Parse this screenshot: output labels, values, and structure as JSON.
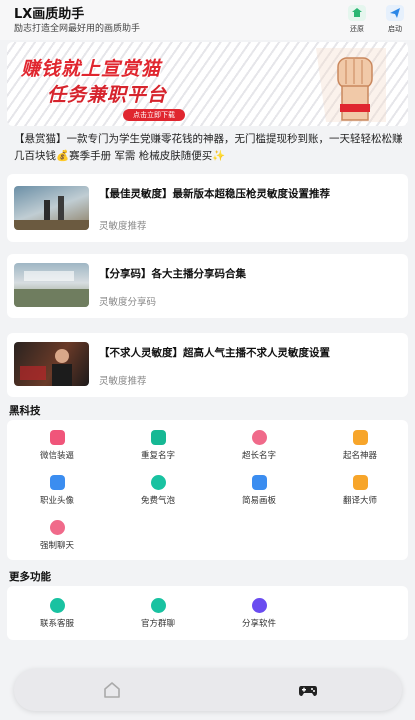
{
  "header": {
    "title": "LX画质助手",
    "subtitle": "励志打造全网最好用的画质助手",
    "buttons": [
      {
        "label": "还原",
        "icon": "restore-icon",
        "color": "#2bb673"
      },
      {
        "label": "启动",
        "icon": "launch-icon",
        "color": "#2b86e6"
      }
    ]
  },
  "banner": {
    "line1": "赚钱就上宣赏猫",
    "line2": "任务兼职平台",
    "cta": "点击立即下载",
    "accent": "#e0262f"
  },
  "description": "【悬赏猫】一款专门为学生党赚零花钱的神器，无门槛提现秒到账，一天轻轻松松赚几百块钱💰赛季手册 军需 枪械皮肤随便买✨",
  "articles": [
    {
      "title": "【最佳灵敏度】最新版本超稳压枪灵敏度设置推荐",
      "tag": "灵敏度推荐"
    },
    {
      "title": "【分享码】各大主播分享码合集",
      "tag": "灵敏度分享码"
    },
    {
      "title": "【不求人灵敏度】超高人气主播不求人灵敏度设置",
      "tag": "灵敏度推荐"
    }
  ],
  "black_tech": {
    "label": "黑科技",
    "items": [
      {
        "label": "微信装逼",
        "icon": "wechat-flex-icon",
        "color": "#f0557a"
      },
      {
        "label": "重复名字",
        "icon": "duplicate-name-icon",
        "color": "#16b894"
      },
      {
        "label": "超长名字",
        "icon": "long-name-icon",
        "color": "#f06a8a"
      },
      {
        "label": "起名神器",
        "icon": "naming-tool-icon",
        "color": "#f7a52a"
      },
      {
        "label": "职业头像",
        "icon": "pro-avatar-icon",
        "color": "#3b8df0"
      },
      {
        "label": "免费气泡",
        "icon": "free-bubble-icon",
        "color": "#19c2a1"
      },
      {
        "label": "简易画板",
        "icon": "drawing-board-icon",
        "color": "#3b8df0"
      },
      {
        "label": "翻译大师",
        "icon": "translator-icon",
        "color": "#f7a52a"
      },
      {
        "label": "强制聊天",
        "icon": "force-chat-icon",
        "color": "#f06a8a"
      }
    ]
  },
  "more": {
    "label": "更多功能",
    "items": [
      {
        "label": "联系客服",
        "icon": "customer-service-icon",
        "color": "#19c2a1"
      },
      {
        "label": "官方群聊",
        "icon": "group-chat-icon",
        "color": "#19c2a1"
      },
      {
        "label": "分享软件",
        "icon": "share-app-icon",
        "color": "#6a4cf0"
      }
    ]
  },
  "nav": [
    {
      "icon": "home-icon"
    },
    {
      "icon": "gamepad-icon"
    }
  ]
}
